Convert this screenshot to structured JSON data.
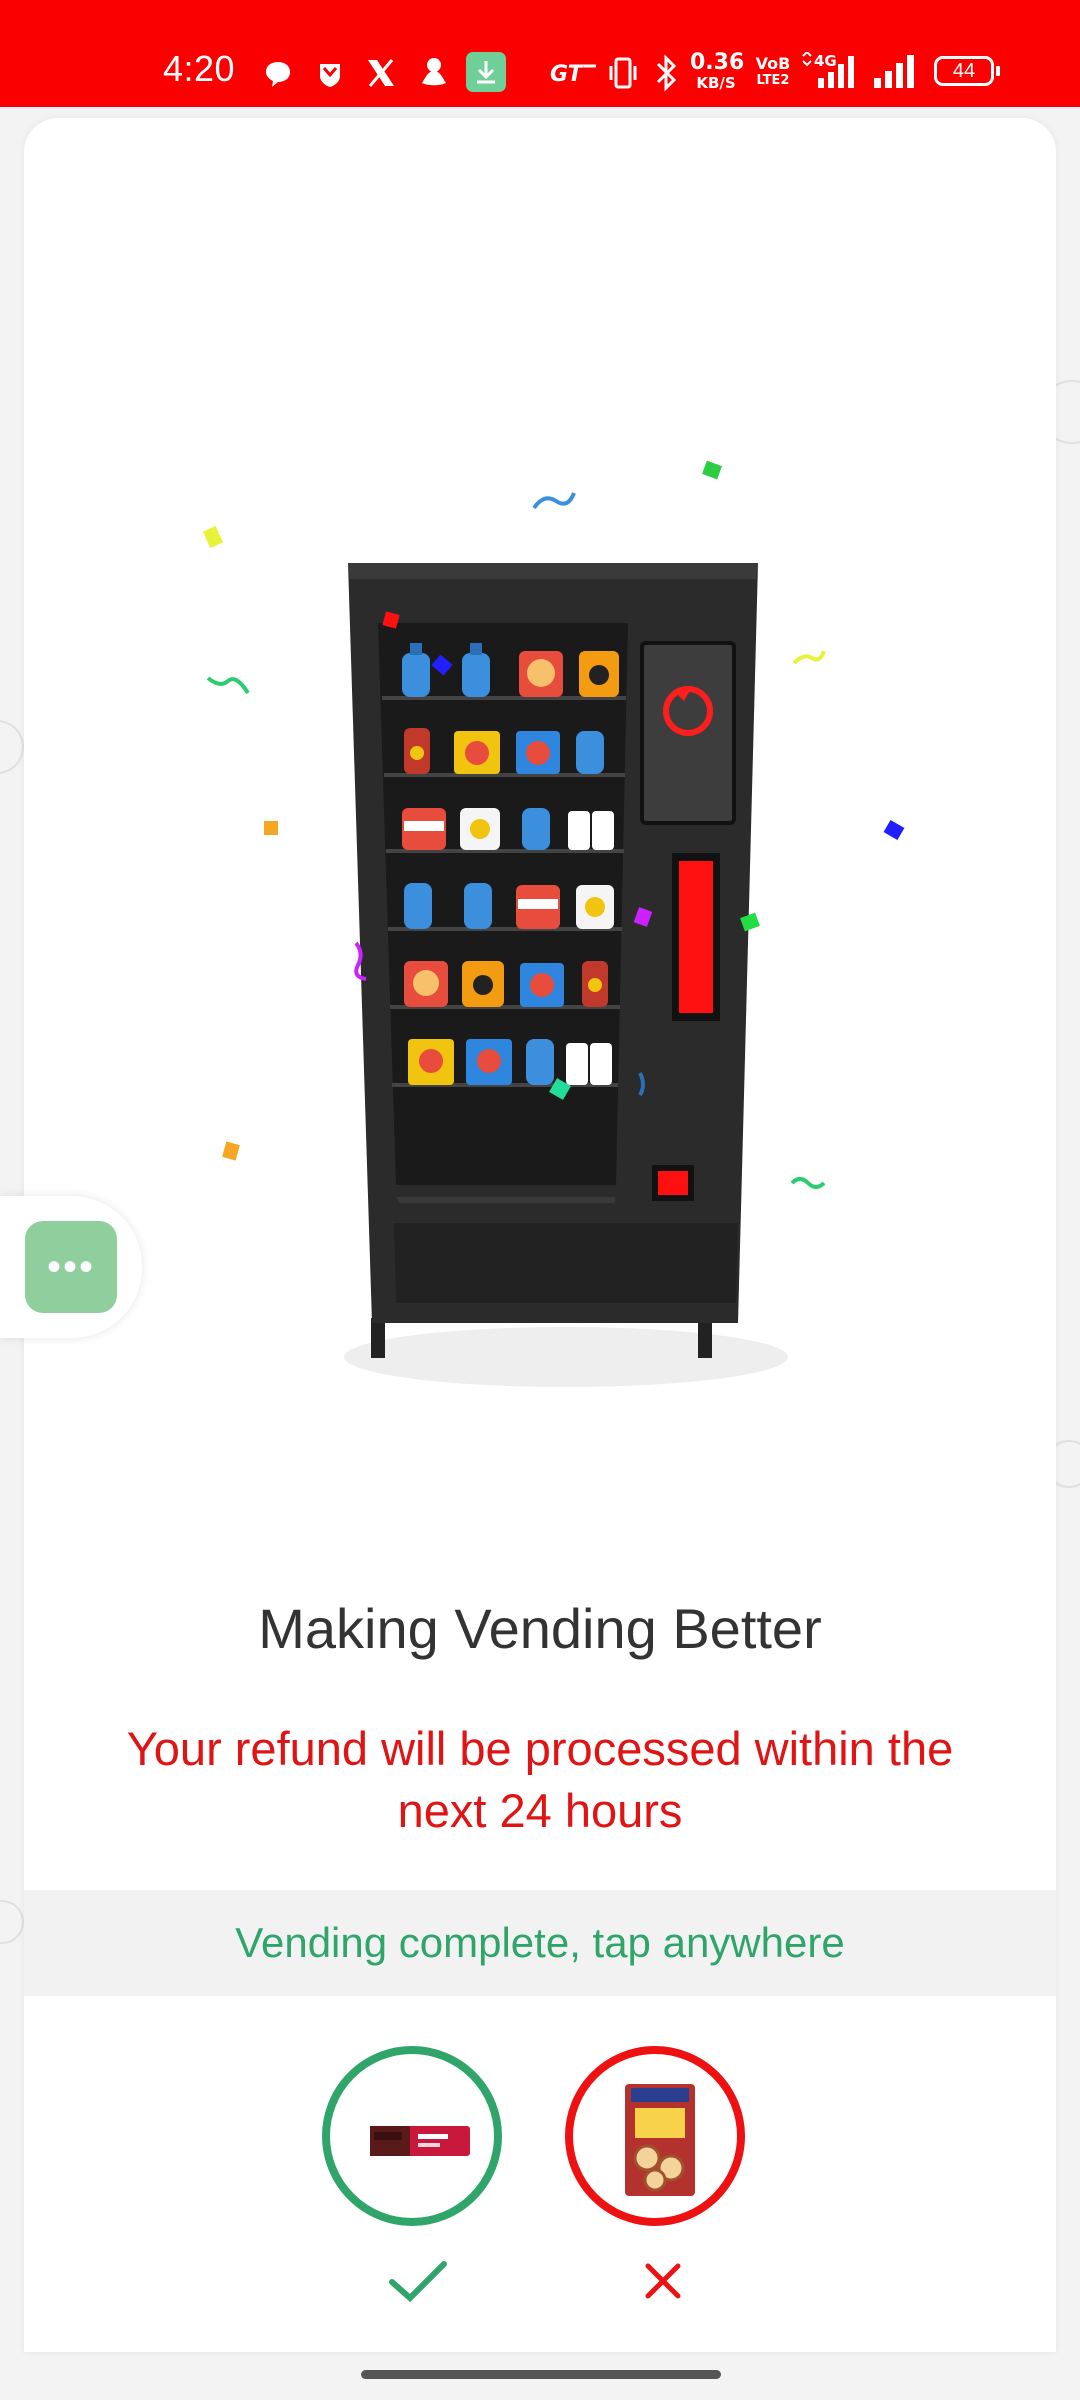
{
  "status_bar": {
    "time": "4:20",
    "network_speed_value": "0.36",
    "network_speed_unit": "KB/S",
    "volte_top": "VoB",
    "volte_bottom": "LTE2",
    "network_type": "4G",
    "battery_level": "44",
    "left_icons": [
      "chat-bubble-icon",
      "shield-icon",
      "x-icon",
      "snapchat-icon",
      "download-icon"
    ],
    "right_icons": [
      "gt-icon",
      "vibrate-icon",
      "bluetooth-icon",
      "signal-icon",
      "signal-icon",
      "battery-icon"
    ]
  },
  "content": {
    "title": "Making Vending Better",
    "refund_message": "Your refund will be processed within the next 24 hours",
    "banner_text": "Vending complete, tap anywhere"
  },
  "vend_items": [
    {
      "name": "protein-bar",
      "status": "success",
      "status_icon": "check-icon",
      "color": "#2fa56a"
    },
    {
      "name": "soya-chips-pack",
      "status": "failed",
      "status_icon": "cross-icon",
      "color": "#ee1111"
    }
  ],
  "fab": {
    "icon": "more-dots-icon",
    "label": "•••"
  },
  "colors": {
    "status_bar": "#fa0000",
    "success": "#2fa56a",
    "error": "#e01414",
    "fab": "#8fcf9e"
  }
}
